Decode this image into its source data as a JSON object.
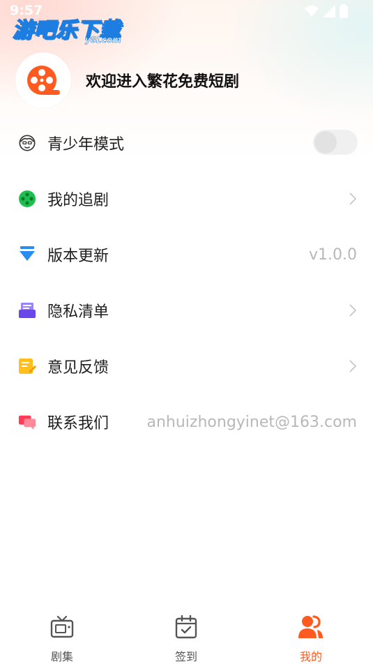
{
  "status_bar": {
    "time": "9:57"
  },
  "watermark": {
    "main": "游吧乐下载",
    "sub": "y8Lcom"
  },
  "profile": {
    "welcome": "欢迎进入繁花免费短剧"
  },
  "menu": [
    {
      "label": "青少年模式",
      "icon": "teen-face-icon",
      "right": "",
      "type": "toggle",
      "toggle_on": false
    },
    {
      "label": "我的追剧",
      "icon": "film-reel-icon",
      "right": "",
      "type": "chevron"
    },
    {
      "label": "版本更新",
      "icon": "download-arrow-icon",
      "right": "v1.0.0",
      "type": "text"
    },
    {
      "label": "隐私清单",
      "icon": "privacy-inbox-icon",
      "right": "",
      "type": "chevron"
    },
    {
      "label": "意见反馈",
      "icon": "feedback-note-icon",
      "right": "",
      "type": "chevron"
    },
    {
      "label": "联系我们",
      "icon": "chat-bubbles-icon",
      "right": "anhuizhongyinet@163.com",
      "type": "text"
    }
  ],
  "tabs": [
    {
      "label": "剧集",
      "icon": "tv-icon",
      "active": false
    },
    {
      "label": "签到",
      "icon": "calendar-check-icon",
      "active": false
    },
    {
      "label": "我的",
      "icon": "people-icon",
      "active": true
    }
  ],
  "colors": {
    "accent": "#ff5a1f",
    "logo": "#ff5a1f",
    "green": "#1fbf4f",
    "blue": "#2a8cf0",
    "purple": "#7c5cf0",
    "yellow": "#ffbf1f",
    "pink": "#ff3b55"
  }
}
